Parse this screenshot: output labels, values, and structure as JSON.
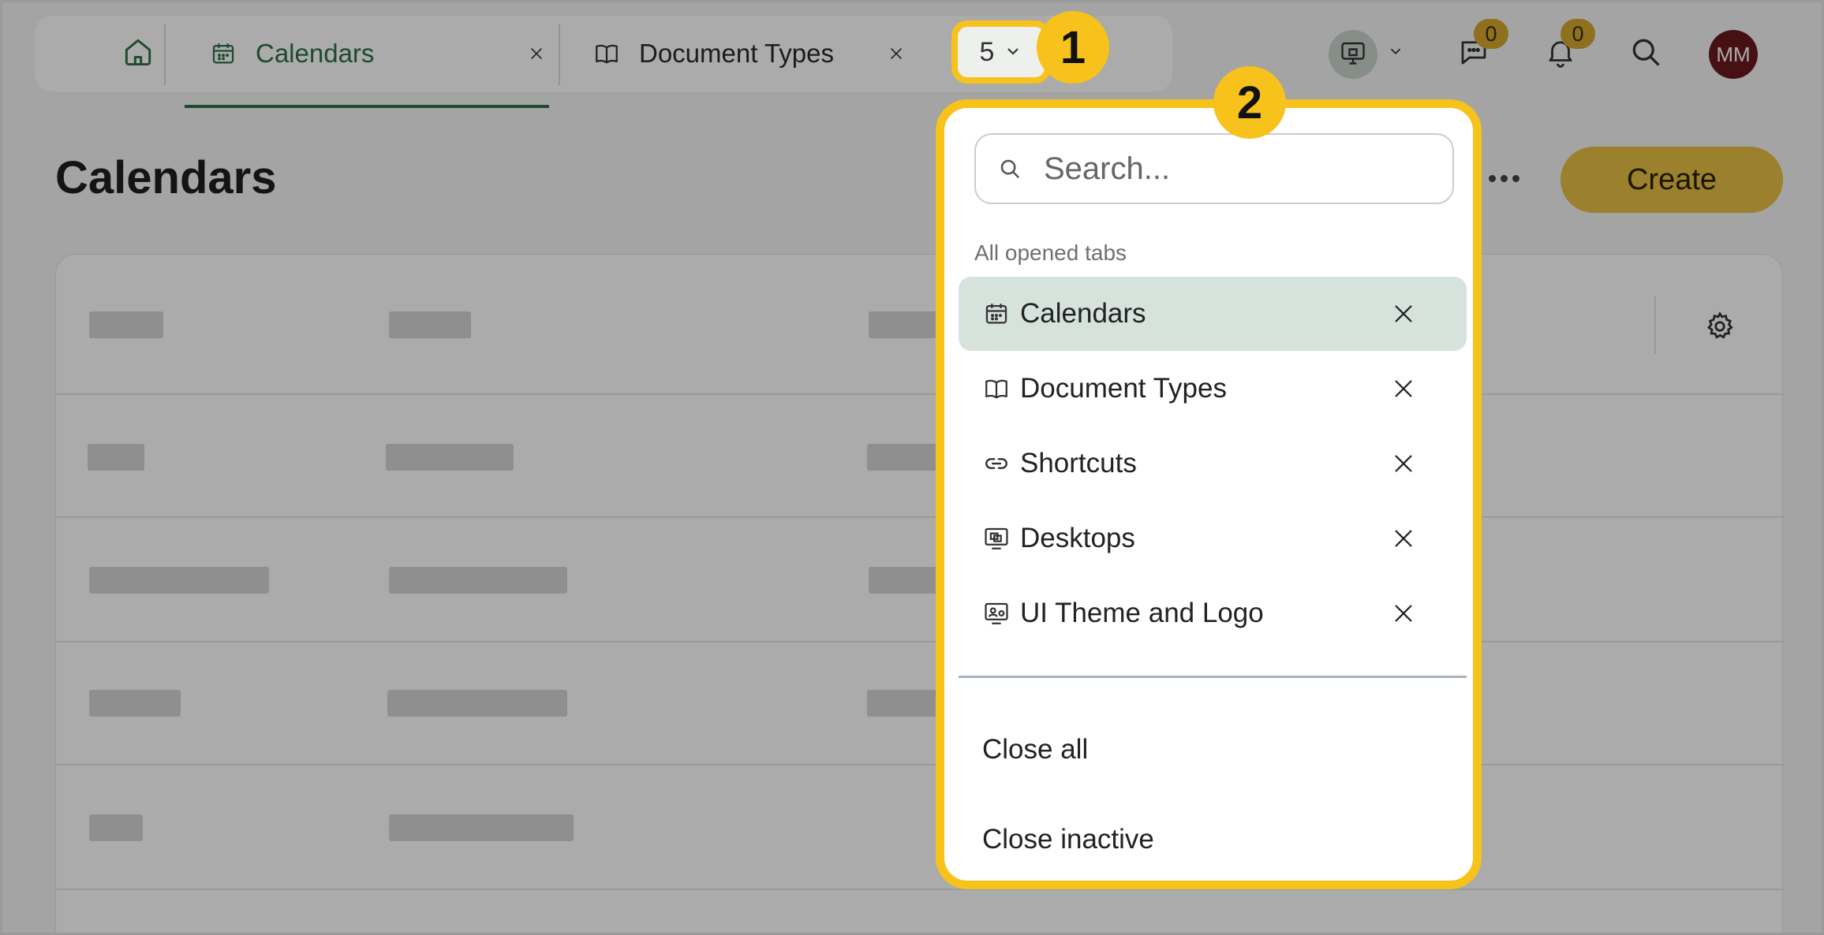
{
  "tabs": {
    "home_icon": "home-icon",
    "items": [
      {
        "label": "Calendars",
        "icon": "calendar-icon",
        "active": true
      },
      {
        "label": "Document Types",
        "icon": "book-icon",
        "active": false
      }
    ],
    "overflow_count": "5"
  },
  "header_tools": {
    "workspace_icon": "workspace-icon",
    "messages_count": "0",
    "notifications_count": "0",
    "user_initials": "MM"
  },
  "page": {
    "title": "Calendars",
    "create_label": "Create"
  },
  "dropdown": {
    "search_placeholder": "Search...",
    "section_label": "All opened tabs",
    "items": [
      {
        "label": "Calendars",
        "icon": "calendar-icon"
      },
      {
        "label": "Document Types",
        "icon": "book-icon"
      },
      {
        "label": "Shortcuts",
        "icon": "link-icon"
      },
      {
        "label": "Desktops",
        "icon": "desktop-icon"
      },
      {
        "label": "UI Theme and Logo",
        "icon": "theme-icon"
      }
    ],
    "close_all_label": "Close all",
    "close_inactive_label": "Close inactive"
  },
  "callouts": [
    "1",
    "2"
  ],
  "colors": {
    "accent_green": "#2e7048",
    "highlight_yellow": "#f6c21b",
    "create_button": "#e7bf45",
    "selected_row": "#d6e2dc",
    "avatar": "#6b1a1f"
  }
}
